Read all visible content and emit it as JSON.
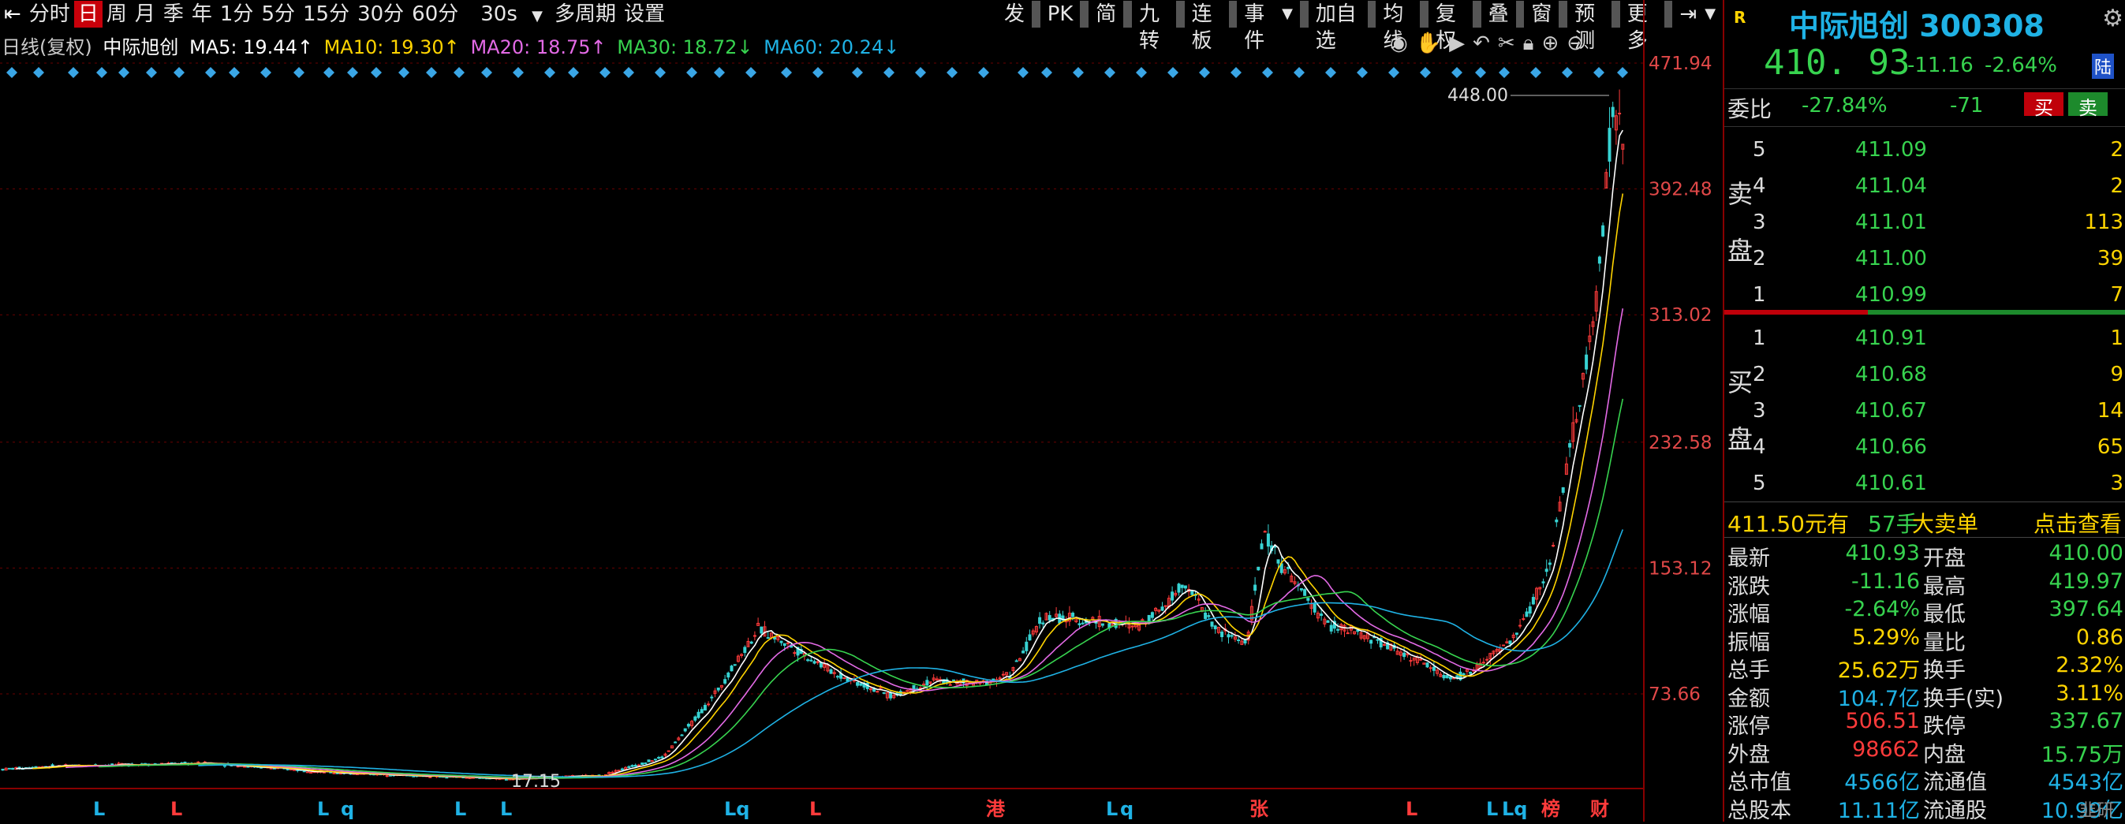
{
  "toolbar": {
    "left_items": [
      "分时",
      "日",
      "周",
      "月",
      "季",
      "年",
      "1分",
      "5分",
      "15分",
      "30分",
      "60分",
      "30s",
      "多周期",
      "设置"
    ],
    "active": "日",
    "right_items": [
      "发",
      "PK",
      "简",
      "九转",
      "连板",
      "事件",
      "加自选",
      "均线",
      "复权",
      "叠",
      "窗",
      "预测",
      "更多"
    ],
    "dropdown_icon": "caret-down-icon",
    "arrow_left_icon": "arrow-to-left-icon",
    "arrow_right_icon": "arrow-to-right-icon"
  },
  "info": {
    "period": "日线(复权)",
    "name": "中际旭创",
    "ma5": "MA5: 19.44↑",
    "ma10": "MA10: 19.30↑",
    "ma20": "MA20: 18.75↑",
    "ma30": "MA30: 18.72↓",
    "ma60": "MA60: 20.24↓",
    "colors": {
      "ma5": "#ffffff",
      "ma10": "#ffd400",
      "ma20": "#e36ae6",
      "ma30": "#37d34f",
      "ma60": "#1fb2e5"
    }
  },
  "yaxis": {
    "ticks": [
      "471.94",
      "392.48",
      "313.02",
      "232.58",
      "153.12",
      "73.66"
    ]
  },
  "annotations": {
    "high": "448.00",
    "low": "17.15"
  },
  "markers": [
    "L",
    "L",
    "L",
    "q",
    "L",
    "L",
    "Lq",
    "L",
    "港",
    "L",
    "q",
    "张",
    "L",
    "L",
    "Lq",
    "榜",
    "财"
  ],
  "quote": {
    "badge": "R",
    "title": "中际旭创 300308",
    "price": "410. 93",
    "change": "-11.16",
    "pct": "-2.64%",
    "tag": "陆",
    "weibi_label": "委比",
    "weibi": "-27.84%",
    "weicha": "-71",
    "buy_btn": "买",
    "sell_btn": "卖",
    "sell_label": [
      "卖",
      "盘"
    ],
    "buy_label": [
      "买",
      "盘"
    ],
    "sells": [
      {
        "n": "5",
        "p": "411.09",
        "v": "2"
      },
      {
        "n": "4",
        "p": "411.04",
        "v": "2"
      },
      {
        "n": "3",
        "p": "411.01",
        "v": "113"
      },
      {
        "n": "2",
        "p": "411.00",
        "v": "39"
      },
      {
        "n": "1",
        "p": "410.99",
        "v": "7"
      }
    ],
    "buys": [
      {
        "n": "1",
        "p": "410.91",
        "v": "1"
      },
      {
        "n": "2",
        "p": "410.68",
        "v": "9"
      },
      {
        "n": "3",
        "p": "410.67",
        "v": "14"
      },
      {
        "n": "4",
        "p": "410.66",
        "v": "65"
      },
      {
        "n": "5",
        "p": "410.61",
        "v": "3"
      }
    ],
    "bigorder": {
      "price": "411.50元有",
      "hands": "57手",
      "label": "大卖单",
      "link": "点击查看"
    },
    "stats": [
      {
        "l1": "最新",
        "v1": "410.93",
        "c1": "#37d34f",
        "l2": "开盘",
        "v2": "410.00",
        "c2": "#37d34f"
      },
      {
        "l1": "涨跌",
        "v1": "-11.16",
        "c1": "#37d34f",
        "l2": "最高",
        "v2": "419.97",
        "c2": "#37d34f"
      },
      {
        "l1": "涨幅",
        "v1": "-2.64%",
        "c1": "#37d34f",
        "l2": "最低",
        "v2": "397.64",
        "c2": "#37d34f"
      },
      {
        "l1": "振幅",
        "v1": "5.29%",
        "c1": "#ffd400",
        "l2": "量比",
        "v2": "0.86",
        "c2": "#ffd400"
      },
      {
        "l1": "总手",
        "v1": "25.62万",
        "c1": "#ffd400",
        "l2": "换手",
        "v2": "2.32%",
        "c2": "#ffd400"
      },
      {
        "l1": "金额",
        "v1": "104.7亿",
        "c1": "#1fb2e5",
        "l2": "换手(实)",
        "v2": "3.11%",
        "c2": "#ffd400"
      },
      {
        "l1": "涨停",
        "v1": "506.51",
        "c1": "#ff3b3b",
        "l2": "跌停",
        "v2": "337.67",
        "c2": "#37d34f"
      },
      {
        "l1": "外盘",
        "v1": "98662",
        "c1": "#ff3b3b",
        "l2": "内盘",
        "v2": "15.75万",
        "c2": "#37d34f"
      },
      {
        "l1": "总市值",
        "v1": "4566亿",
        "c1": "#1fb2e5",
        "l2": "流通值",
        "v2": "4543亿",
        "c2": "#1fb2e5"
      },
      {
        "l1": "总股本",
        "v1": "11.11亿",
        "c1": "#1fb2e5",
        "l2": "流通股",
        "v2": "10.99亿",
        "c2": "#1fb2e5"
      }
    ],
    "watermark": "韭研"
  },
  "chart_data": {
    "type": "line",
    "title": "",
    "ylim": [
      0,
      480
    ],
    "y_ticks": [
      471.94,
      392.48,
      313.02,
      232.58,
      153.12,
      73.66
    ],
    "x": [
      0,
      4,
      8,
      12,
      16,
      20,
      22,
      24,
      26,
      28,
      30,
      32,
      34,
      36,
      38,
      40,
      42,
      44,
      46,
      48,
      50,
      52,
      54,
      56,
      58,
      60,
      62,
      64,
      66,
      68,
      70,
      72,
      74,
      76,
      78,
      80,
      82,
      84,
      86,
      88,
      90,
      92,
      94,
      96,
      98,
      100
    ],
    "series": [
      {
        "name": "MA5",
        "values": [
          26,
          27,
          27,
          25,
          23,
          21,
          20,
          22,
          28,
          42,
          60,
          80,
          110,
          114,
          95,
          88,
          80,
          72,
          70,
          73,
          76,
          80,
          85,
          78,
          81,
          122,
          118,
          120,
          116,
          124,
          147,
          142,
          120,
          106,
          126,
          178,
          160,
          128,
          122,
          108,
          102,
          95,
          83,
          80,
          84,
          95,
          115,
          140,
          175,
          230,
          290,
          360,
          420,
          395
        ]
      }
    ]
  }
}
